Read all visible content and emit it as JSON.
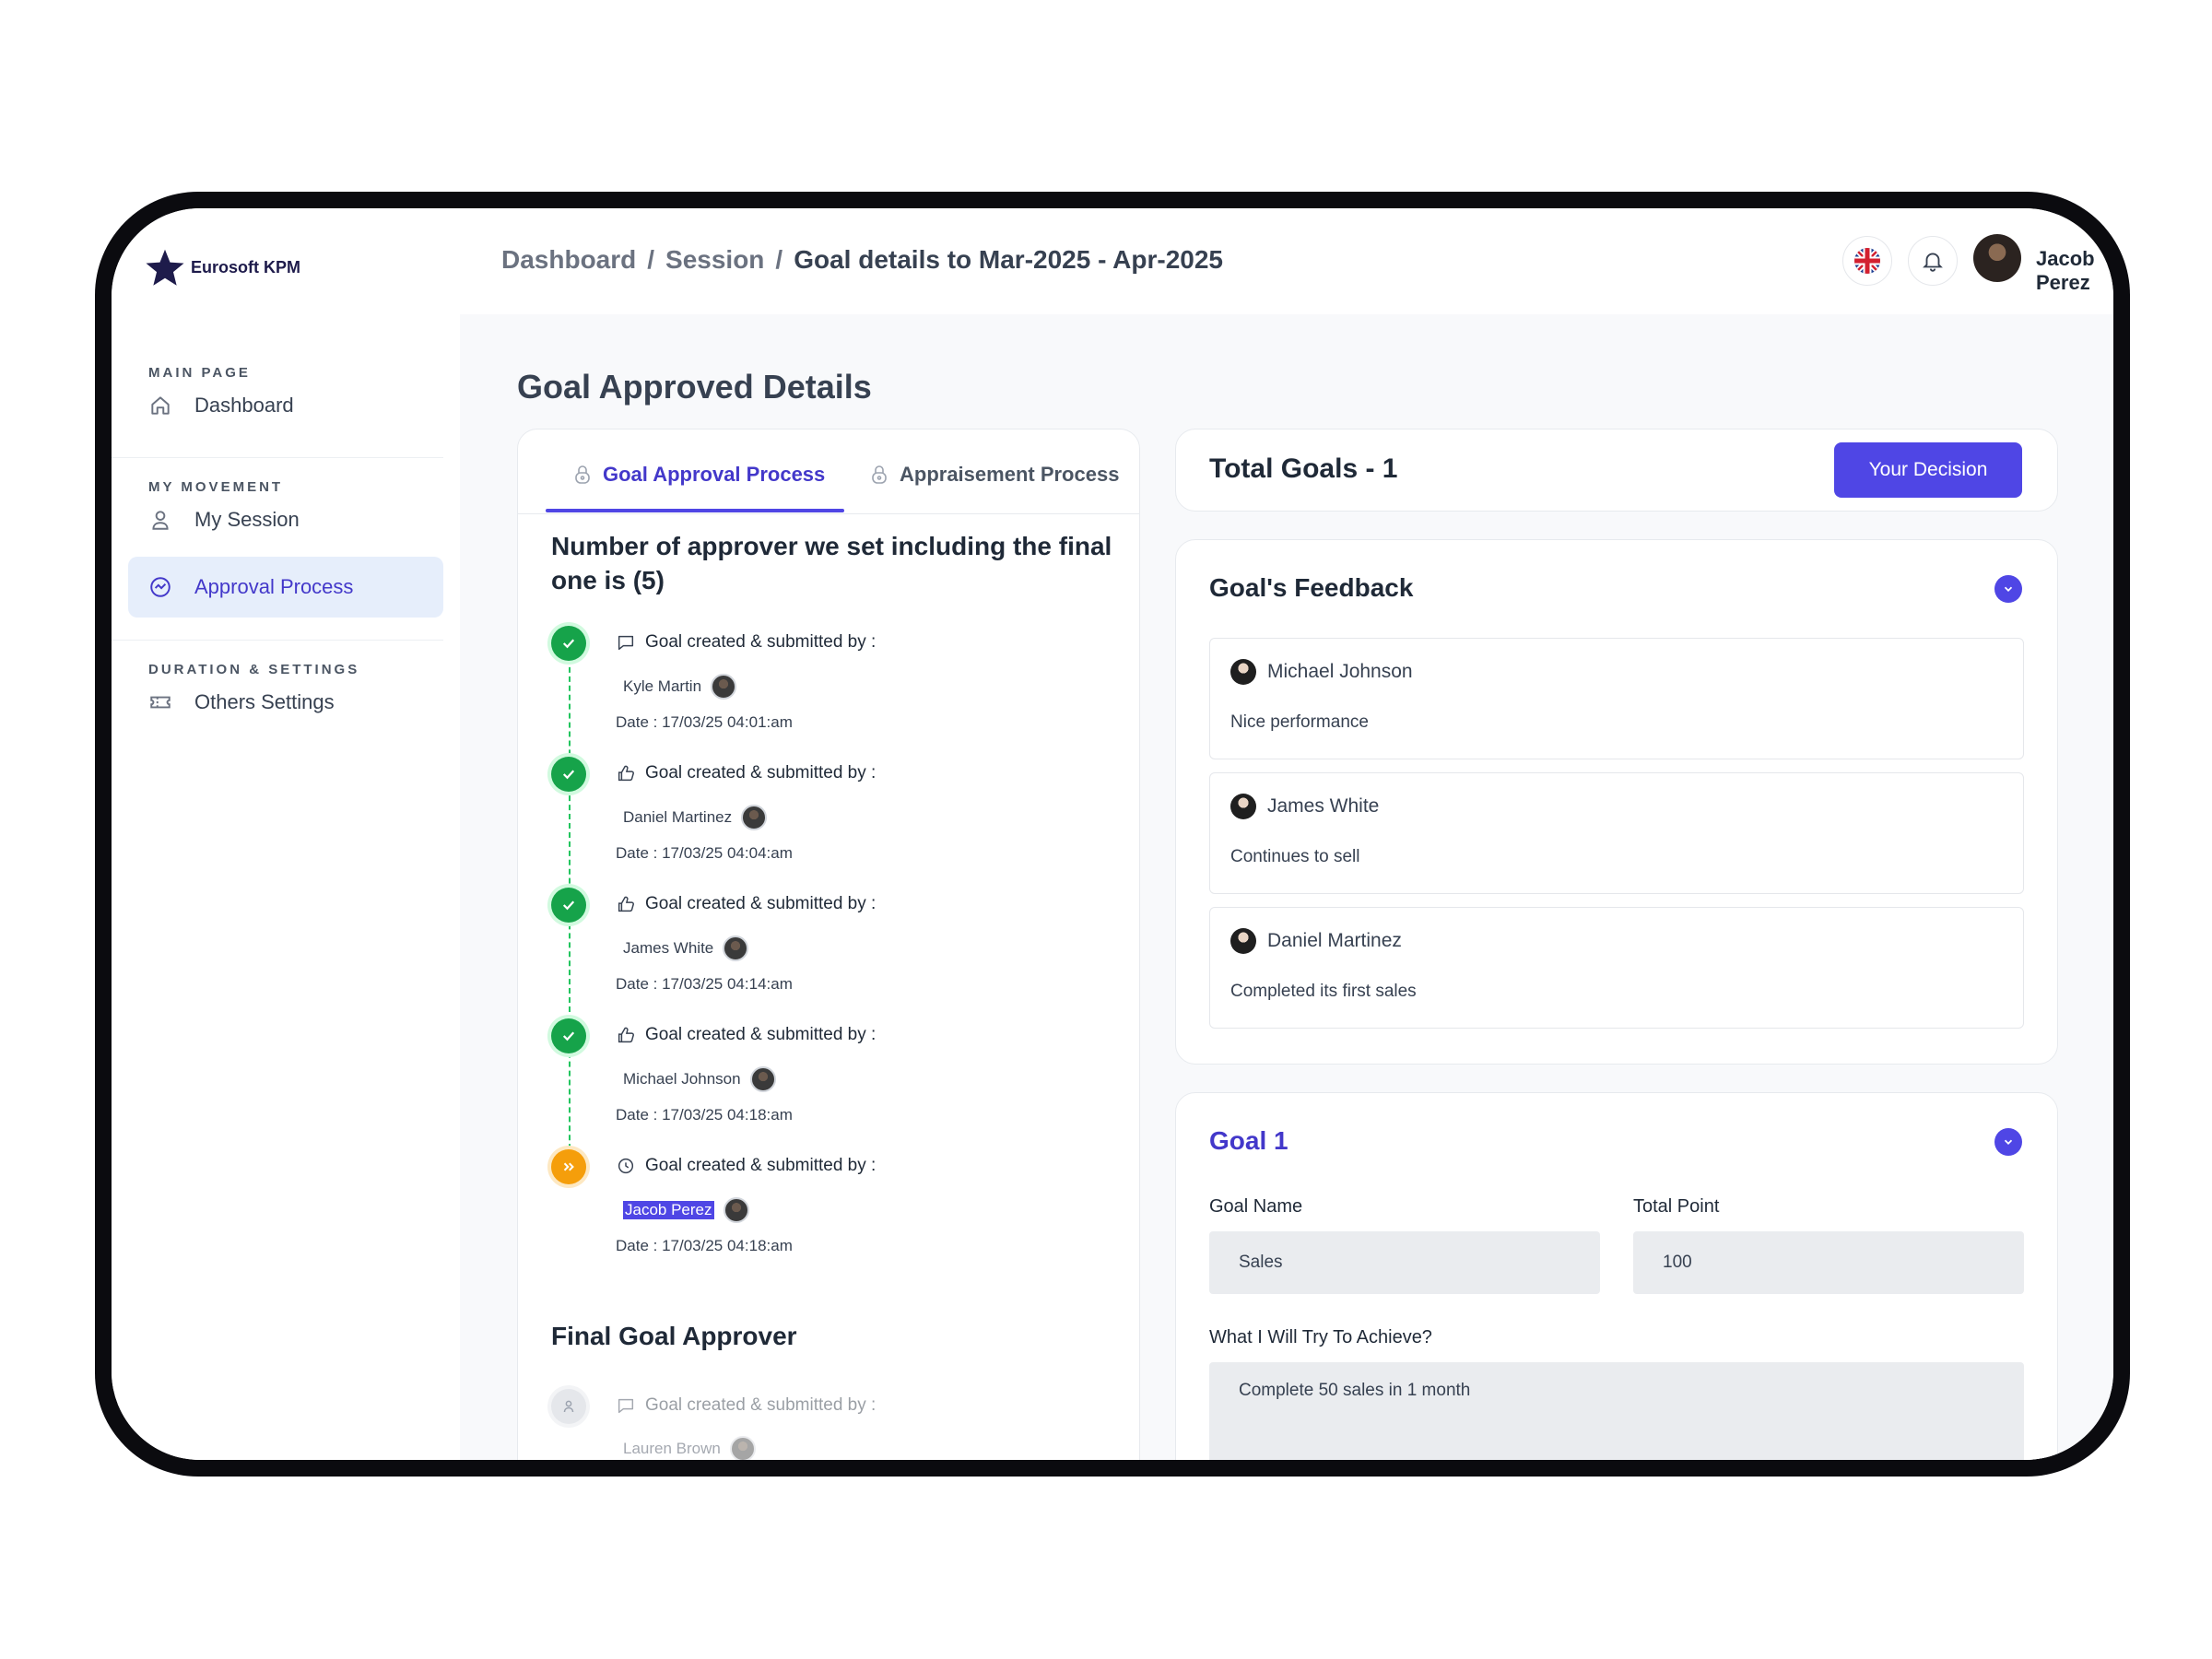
{
  "brand": {
    "name": "Eurosoft KPM",
    "accent": "#4f46e5",
    "logo_color": "#1e1b4b"
  },
  "sidebar": {
    "sections": [
      {
        "label": "MAIN PAGE",
        "items": [
          {
            "label": "Dashboard",
            "icon": "home-icon"
          }
        ]
      },
      {
        "label": "MY MOVEMENT",
        "items": [
          {
            "label": "My Session",
            "icon": "user-icon"
          },
          {
            "label": "Approval Process",
            "icon": "approval-icon",
            "active": true
          }
        ]
      },
      {
        "label": "DURATION & SETTINGS",
        "items": [
          {
            "label": "Others Settings",
            "icon": "ticket-icon"
          }
        ]
      }
    ]
  },
  "header": {
    "breadcrumb": [
      "Dashboard",
      "/",
      "Session",
      "/",
      "Goal details to Mar-2025 - Apr-2025"
    ],
    "user_name": "Jacob Perez",
    "language_icon": "uk-flag-icon",
    "notification_icon": "bell-icon"
  },
  "main": {
    "title": "Goal Approved Details",
    "tabs": [
      {
        "label": "Goal Approval Process",
        "active": true
      },
      {
        "label": "Appraisement Process",
        "active": false
      }
    ],
    "approver_count": "Number of approver we set including the final one is (5)",
    "steps": [
      {
        "action": "Goal created & submitted by :",
        "icon": "comment-icon",
        "user": "Kyle Martin",
        "date": "Date : 17/03/25 04:01:am",
        "status": "done"
      },
      {
        "action": "Goal created & submitted by :",
        "icon": "thumbs-up-icon",
        "user": "Daniel Martinez",
        "date": "Date : 17/03/25 04:04:am",
        "status": "done"
      },
      {
        "action": "Goal created & submitted by :",
        "icon": "thumbs-up-icon",
        "user": "James White",
        "date": "Date : 17/03/25 04:14:am",
        "status": "done"
      },
      {
        "action": "Goal created & submitted by :",
        "icon": "thumbs-up-icon",
        "user": "Michael Johnson",
        "date": "Date : 17/03/25 04:18:am",
        "status": "done"
      },
      {
        "action": "Goal created & submitted by :",
        "icon": "clock-icon",
        "user": "Jacob Perez",
        "date": "Date : 17/03/25 04:18:am",
        "status": "pending"
      }
    ],
    "final_approver": {
      "title": "Final Goal Approver",
      "action": "Goal created & submitted by :",
      "user": "Lauren Brown"
    },
    "total_goals": "Total Goals - 1",
    "decision_button": "Your Decision",
    "feedback": {
      "title": "Goal's Feedback",
      "items": [
        {
          "user": "Michael Johnson",
          "text": "Nice performance"
        },
        {
          "user": "James White",
          "text": "Continues to sell"
        },
        {
          "user": "Daniel Martinez",
          "text": "Completed its first sales"
        }
      ]
    },
    "goal": {
      "title": "Goal 1",
      "name_label": "Goal Name",
      "name_value": "Sales",
      "point_label": "Total Point",
      "point_value": "100",
      "achieve_label": "What I Will Try To Achieve?",
      "achieve_value": "Complete 50 sales in 1 month"
    }
  }
}
